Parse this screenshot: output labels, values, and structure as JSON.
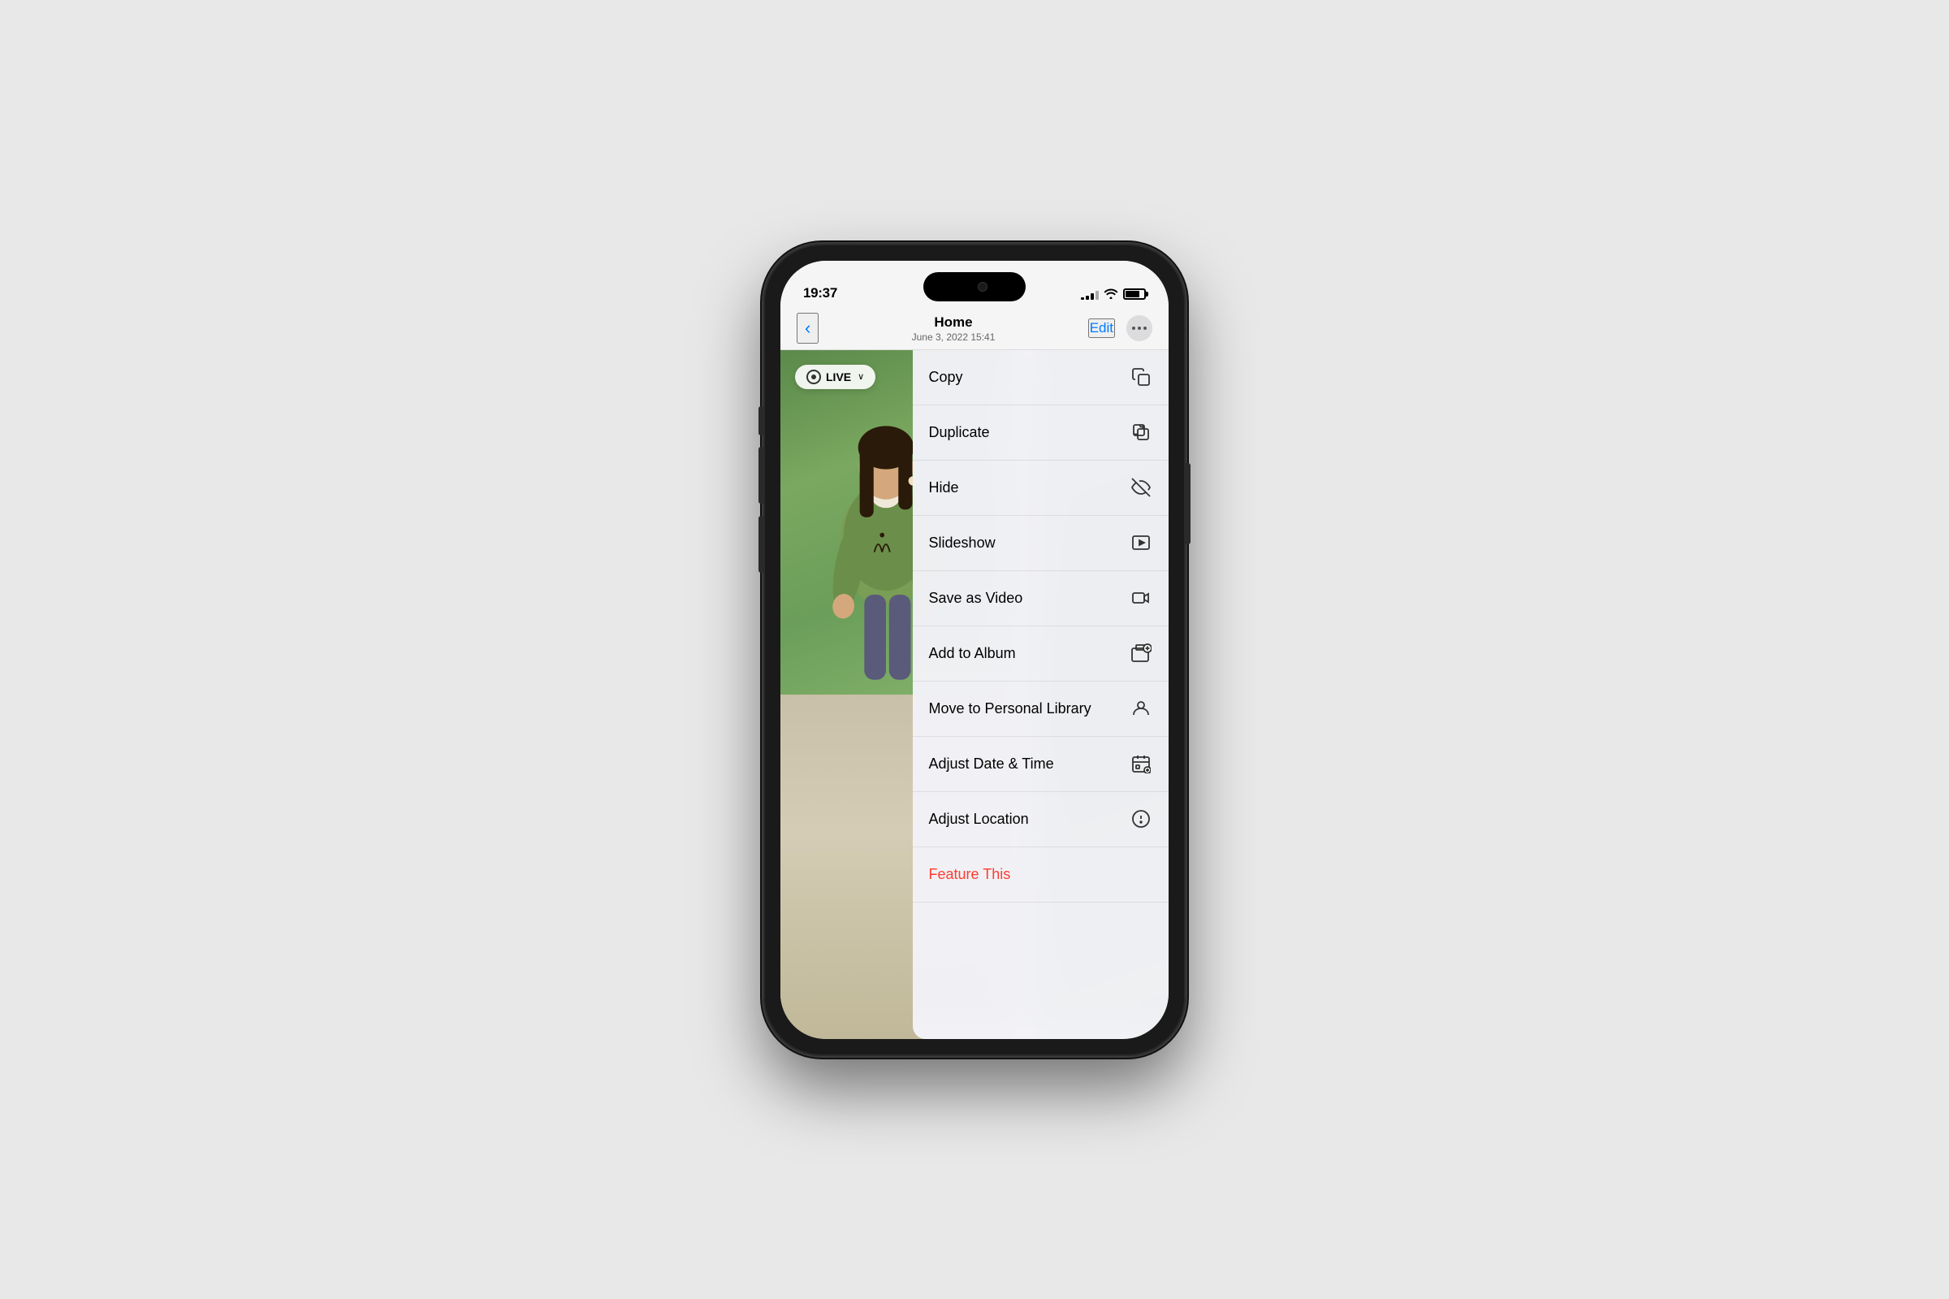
{
  "status": {
    "time": "19:37",
    "signal_bars": [
      3,
      5,
      8,
      11,
      14
    ],
    "wifi": "wifi",
    "battery_level": 75
  },
  "nav": {
    "back_label": "‹",
    "title": "Home",
    "subtitle": "June 3, 2022  15:41",
    "edit_label": "Edit",
    "more_label": "···"
  },
  "photo": {
    "live_label": "LIVE",
    "live_chevron": "∨"
  },
  "context_menu": {
    "items": [
      {
        "id": "copy",
        "label": "Copy",
        "icon": "⎘"
      },
      {
        "id": "duplicate",
        "label": "Duplicate",
        "icon": "⊞"
      },
      {
        "id": "hide",
        "label": "Hide",
        "icon": "⊘"
      },
      {
        "id": "slideshow",
        "label": "Slideshow",
        "icon": "▶"
      },
      {
        "id": "save-as-video",
        "label": "Save as Video",
        "icon": "⬛"
      },
      {
        "id": "add-to-album",
        "label": "Add to Album",
        "icon": "⊕"
      },
      {
        "id": "move-to-personal-library",
        "label": "Move to Personal Library",
        "icon": "👤"
      },
      {
        "id": "adjust-date-time",
        "label": "Adjust Date & Time",
        "icon": "📅"
      },
      {
        "id": "adjust-location",
        "label": "Adjust Location",
        "icon": "ℹ"
      },
      {
        "id": "feature-this",
        "label": "Feature This",
        "icon": "",
        "style": "feature"
      }
    ]
  }
}
